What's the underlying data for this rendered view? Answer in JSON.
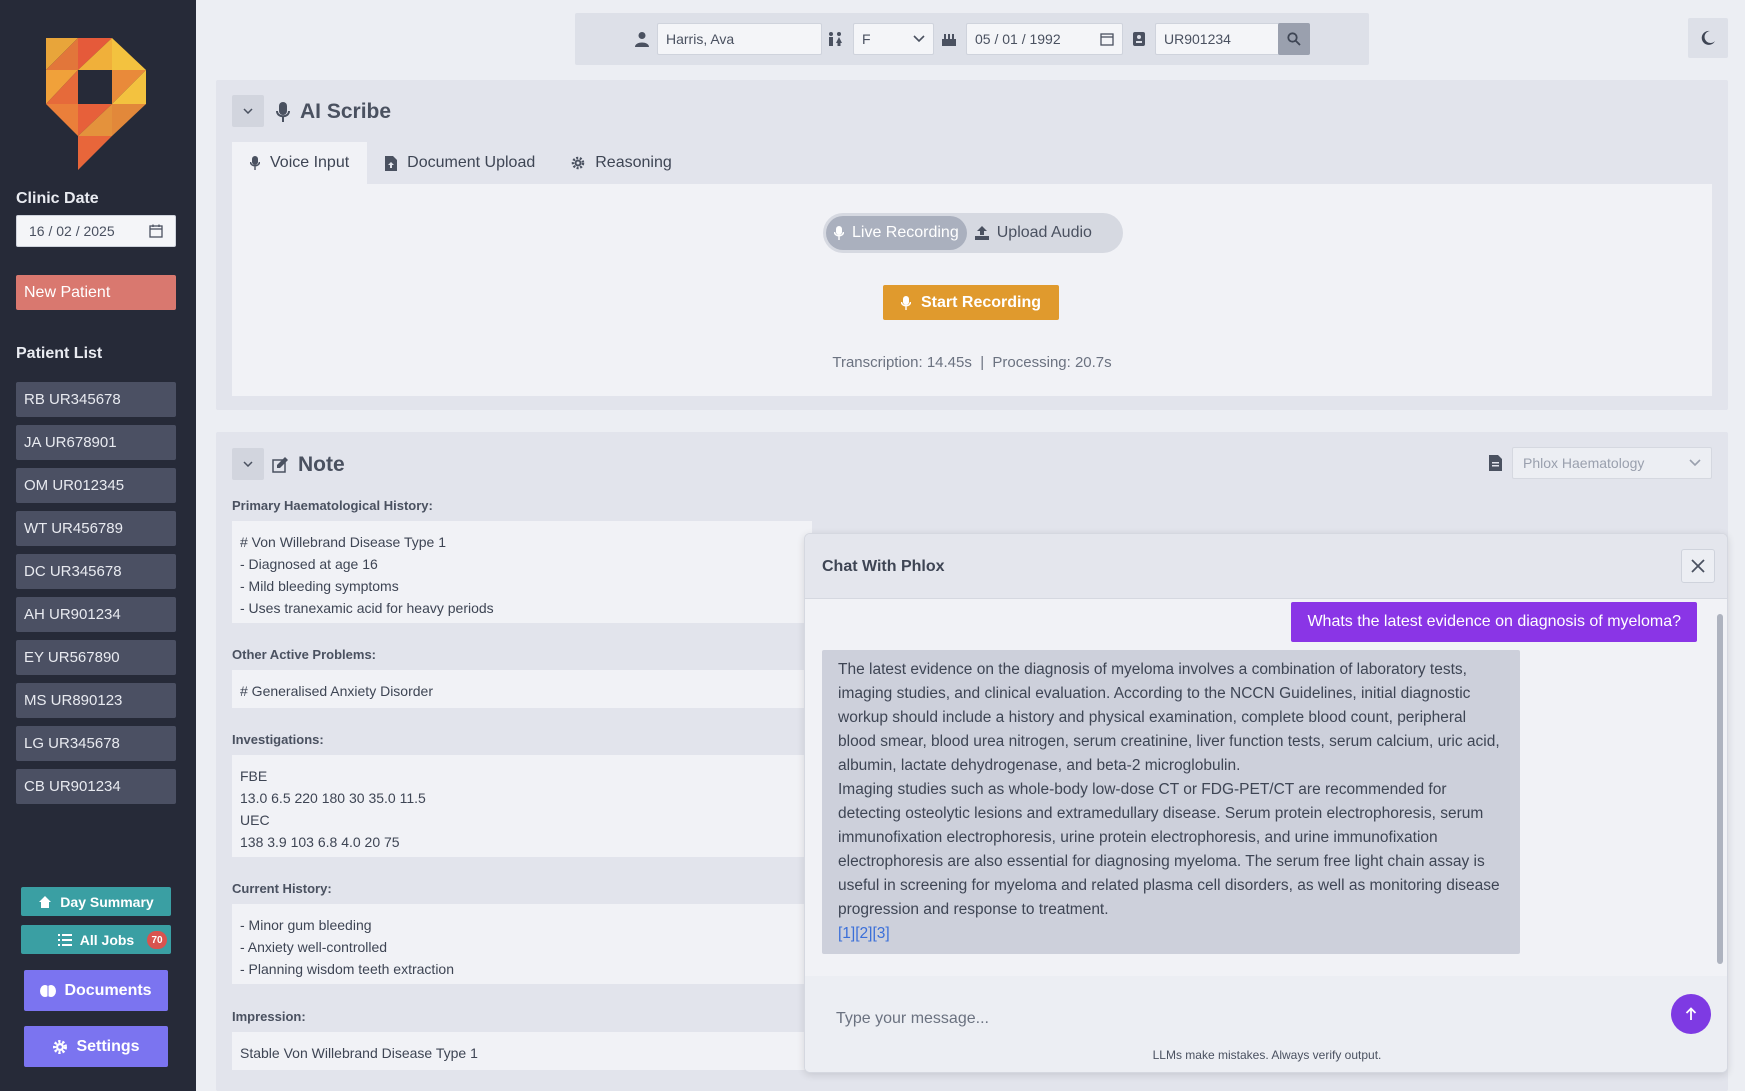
{
  "patient_bar": {
    "name": "Harris, Ava",
    "gender": "F",
    "dob": "05 / 01 / 1992",
    "ur_number": "UR901234"
  },
  "sidebar": {
    "clinic_date_label": "Clinic Date",
    "clinic_date": "16 / 02 / 2025",
    "new_patient": "New Patient",
    "patient_list_label": "Patient List",
    "patients": [
      {
        "label": "RB UR345678"
      },
      {
        "label": "JA UR678901"
      },
      {
        "label": "OM UR012345"
      },
      {
        "label": "WT UR456789"
      },
      {
        "label": "DC UR345678"
      },
      {
        "label": "AH UR901234"
      },
      {
        "label": "EY UR567890"
      },
      {
        "label": "MS UR890123"
      },
      {
        "label": "LG UR345678"
      },
      {
        "label": "CB UR901234"
      }
    ],
    "day_summary": "Day Summary",
    "all_jobs": "All Jobs",
    "all_jobs_count": "70",
    "documents": "Documents",
    "settings": "Settings"
  },
  "scribe": {
    "title": "AI Scribe",
    "tabs": [
      {
        "label": "Voice Input"
      },
      {
        "label": "Document Upload"
      },
      {
        "label": "Reasoning"
      }
    ],
    "mode_live": "Live Recording",
    "mode_upload": "Upload Audio",
    "start_recording": "Start Recording",
    "timing": "Transcription: 14.45s  |  Processing: 20.7s"
  },
  "note": {
    "title": "Note",
    "template": "Phlox Haematology",
    "sections": [
      {
        "label": "Primary Haematological History:",
        "content": "# Von Willebrand Disease Type 1\n- Diagnosed at age 16\n- Mild bleeding symptoms\n- Uses tranexamic acid for heavy periods"
      },
      {
        "label": "Other Active Problems:",
        "content": "# Generalised Anxiety Disorder"
      },
      {
        "label": "Investigations:",
        "content": "FBE\n13.0 6.5 220 180 30 35.0 11.5\nUEC\n138 3.9 103 6.8 4.0 20 75"
      },
      {
        "label": "Current History:",
        "content": "- Minor gum bleeding\n- Anxiety well-controlled\n- Planning wisdom teeth extraction"
      },
      {
        "label": "Impression:",
        "content": "Stable Von Willebrand Disease Type 1"
      }
    ]
  },
  "chat": {
    "title": "Chat With Phlox",
    "user_message": "Whats the latest evidence on diagnosis of myeloma?",
    "bot_message_p1": "The latest evidence on the diagnosis of myeloma involves a combination of laboratory tests, imaging studies, and clinical evaluation. According to the NCCN Guidelines, initial diagnostic workup should include a history and physical examination, complete blood count, peripheral blood smear, blood urea nitrogen, serum creatinine, liver function tests, serum calcium, uric acid, albumin, lactate dehydrogenase, and beta-2 microglobulin.",
    "bot_message_p2": "Imaging studies such as whole-body low-dose CT or FDG-PET/CT are recommended for detecting osteolytic lesions and extramedullary disease. Serum protein electrophoresis, serum immunofixation electrophoresis, urine protein electrophoresis, and urine immunofixation electrophoresis are also essential for diagnosing myeloma. The serum free light chain assay is useful in screening for myeloma and related plasma cell disorders, as well as monitoring disease progression and response to treatment.",
    "refs": "[1][2][3]",
    "input_placeholder": "Type your message...",
    "disclaimer": "LLMs make mistakes. Always verify output."
  },
  "colors": {
    "sidebar_bg": "#262a38",
    "new_patient": "#d9786f",
    "teal": "#3a9fa3",
    "purple": "#7b74f0",
    "record": "#e09a2d",
    "chat_user": "#8a35e6"
  }
}
